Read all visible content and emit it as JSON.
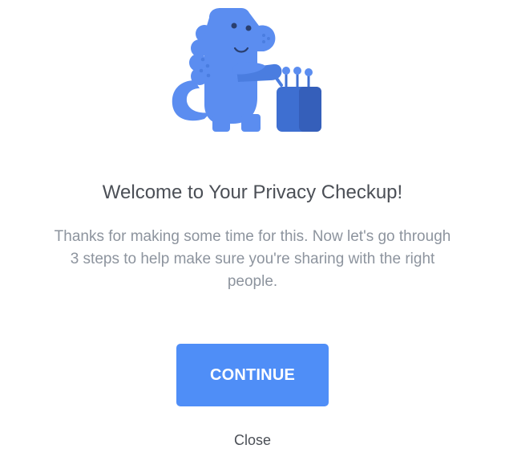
{
  "illustration": {
    "icon": "dinosaur-with-computer-icon",
    "colors": {
      "body": "#5b8df0",
      "belly": "#4a7de0",
      "device": "#3e6fd1",
      "eye": "#2a3f6f"
    }
  },
  "welcome": {
    "title": "Welcome to Your Privacy Checkup!",
    "body": "Thanks for making some time for this. Now let's go through 3 steps to help make sure you're sharing with the right people."
  },
  "actions": {
    "continue_label": "CONTINUE",
    "close_label": "Close"
  },
  "colors": {
    "primary": "#4f8ef7",
    "title_text": "#4b4f56",
    "body_text": "#8d949e"
  }
}
